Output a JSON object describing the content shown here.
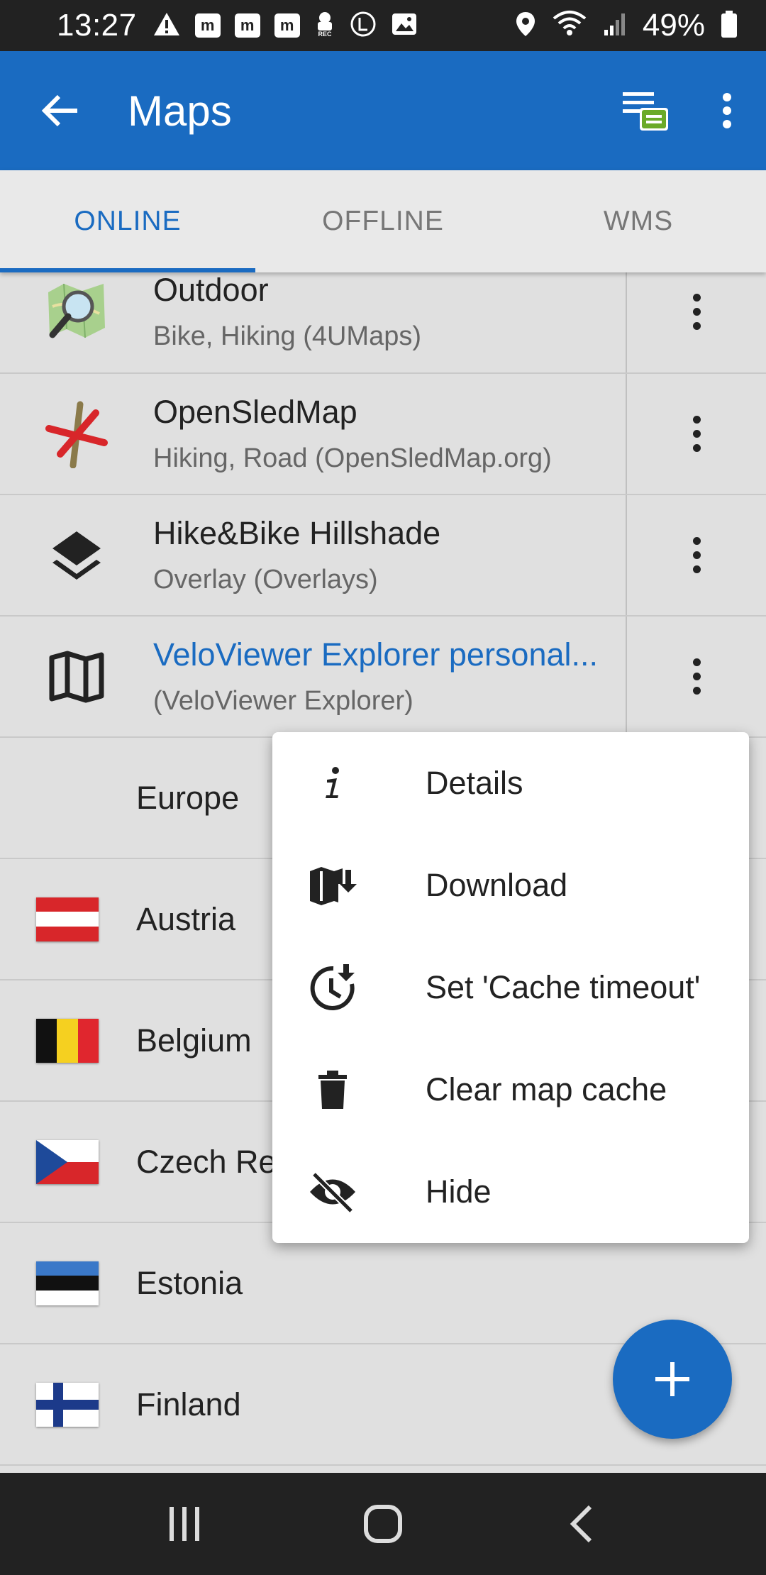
{
  "status_bar": {
    "time": "13:27",
    "battery": "49%",
    "left_icons": [
      "warning-icon",
      "m-notification-icon",
      "m-notification-icon",
      "m-notification-icon",
      "rec-icon",
      "l-circle-icon",
      "image-icon"
    ],
    "right_icons": [
      "location-icon",
      "wifi-icon",
      "signal-icon",
      "battery-icon"
    ]
  },
  "app_bar": {
    "title": "Maps",
    "back_icon": "arrow-left-icon",
    "actions": [
      "list-filter-icon",
      "more-vert-icon"
    ]
  },
  "tabs": [
    {
      "label": "ONLINE",
      "active": true
    },
    {
      "label": "OFFLINE",
      "active": false
    },
    {
      "label": "WMS",
      "active": false
    }
  ],
  "map_items": [
    {
      "name": "Outdoor",
      "subtitle": "Bike, Hiking (4UMaps)",
      "icon": "osm-magnifier-icon"
    },
    {
      "name": "OpenSledMap",
      "subtitle": "Hiking, Road (OpenSledMap.org)",
      "icon": "sled-cross-icon"
    },
    {
      "name": "Hike&Bike Hillshade",
      "subtitle": "Overlay (Overlays)",
      "icon": "layers-icon"
    },
    {
      "name": "VeloViewer Explorer personal...",
      "subtitle": " (VeloViewer Explorer)",
      "icon": "map-icon"
    }
  ],
  "group_header": "Europe",
  "countries": [
    {
      "name": "Austria"
    },
    {
      "name": "Belgium"
    },
    {
      "name": "Czech Republic"
    },
    {
      "name": "Estonia"
    },
    {
      "name": "Finland"
    }
  ],
  "popup_menu": [
    {
      "label": "Details",
      "icon": "info-icon"
    },
    {
      "label": "Download",
      "icon": "map-download-icon"
    },
    {
      "label": "Set 'Cache timeout'",
      "icon": "clock-download-icon"
    },
    {
      "label": "Clear map cache",
      "icon": "trash-icon"
    },
    {
      "label": "Hide",
      "icon": "eye-off-icon"
    }
  ],
  "fab": {
    "icon": "plus-icon"
  },
  "nav_bar": [
    "recent-apps-icon",
    "home-icon",
    "back-icon"
  ],
  "colors": {
    "primary": "#1a6bc1",
    "status_bar": "#222222",
    "background": "#e0e0e0"
  }
}
